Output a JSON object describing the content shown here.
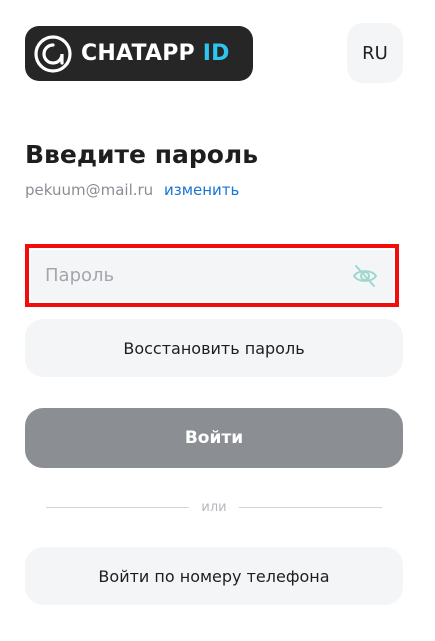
{
  "header": {
    "logo_text_main": "CHATAPP",
    "logo_text_accent": "ID",
    "logo_icon": "chatapp-logo-icon",
    "language_button": "RU"
  },
  "login": {
    "title": "Введите пароль",
    "email": "pekuum@mail.ru",
    "change_link": "изменить",
    "password_placeholder": "Пароль",
    "password_value": "",
    "toggle_visibility_icon": "eye-off-icon",
    "restore_button": "Восстановить пароль",
    "login_button": "Войти",
    "divider_text": "или",
    "phone_login_button": "Войти по номеру телефона"
  },
  "colors": {
    "accent": "#2ec4f1",
    "link": "#1a73d9",
    "highlight_border": "#f20d0d",
    "primary_button_bg": "#8b8f94",
    "field_bg": "#f4f5f7"
  }
}
